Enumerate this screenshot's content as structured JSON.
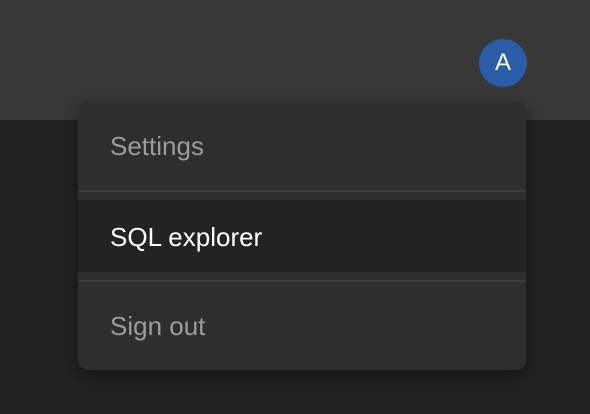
{
  "header": {
    "avatar_initial": "A"
  },
  "account_menu": {
    "items": [
      {
        "label": "Settings",
        "state": "default"
      },
      {
        "label": "SQL explorer",
        "state": "highlighted"
      },
      {
        "label": "Sign out",
        "state": "default"
      }
    ]
  },
  "colors": {
    "header_background": "#383838",
    "page_background": "#232323",
    "menu_background": "#2e2e2e",
    "highlight_background": "#232323",
    "avatar_background": "#2a5ca8",
    "muted_text": "#9c9c9c",
    "active_text": "#ffffff"
  }
}
